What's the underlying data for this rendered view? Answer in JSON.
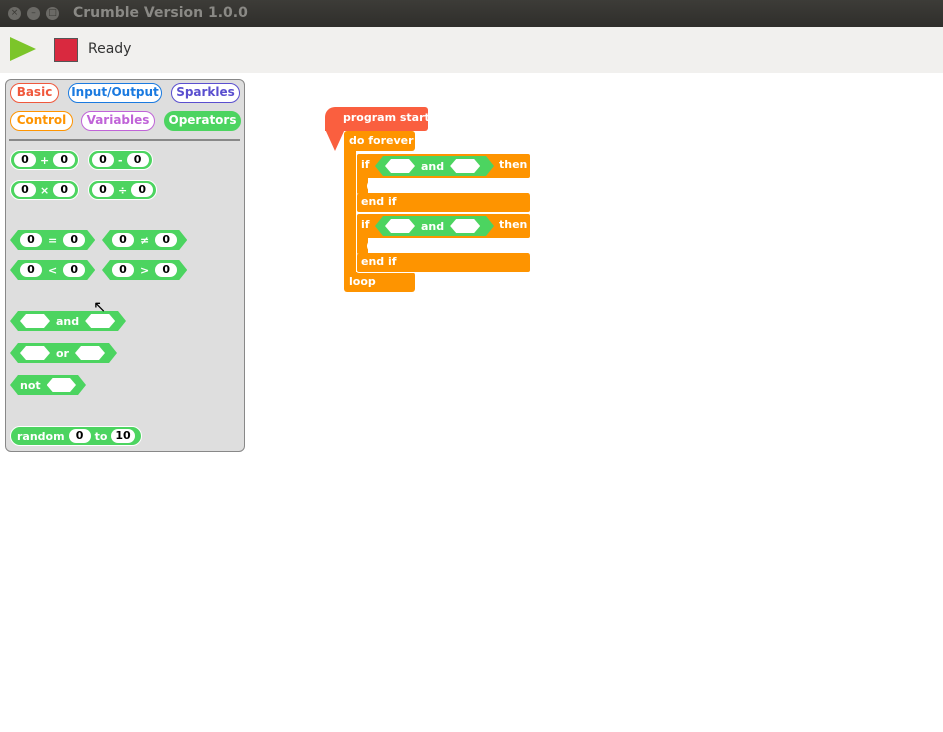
{
  "window": {
    "title": "Crumble Version 1.0.0"
  },
  "toolbar": {
    "status": "Ready"
  },
  "palette": {
    "tabs": [
      {
        "label": "Basic",
        "color": "#f0583c"
      },
      {
        "label": "Input/Output",
        "color": "#1a7ae0"
      },
      {
        "label": "Sparkles",
        "color": "#5a4fcf"
      },
      {
        "label": "Control",
        "color": "#fe9400"
      },
      {
        "label": "Variables",
        "color": "#c064d8"
      },
      {
        "label": "Operators",
        "color": "#4cd460"
      }
    ],
    "ops": {
      "add": "+",
      "sub": "-",
      "mul": "×",
      "div": "÷",
      "eq": "=",
      "neq": "≠",
      "lt": "<",
      "gt": ">",
      "zero": "0"
    },
    "and": "and",
    "or": "or",
    "not": "not",
    "random": {
      "label": "random",
      "to": "to",
      "min": "0",
      "max": "10"
    }
  },
  "script": {
    "start": "program start",
    "forever": "do forever",
    "if": "if",
    "and": "and",
    "then": "then",
    "endif": "end if",
    "loop": "loop"
  }
}
